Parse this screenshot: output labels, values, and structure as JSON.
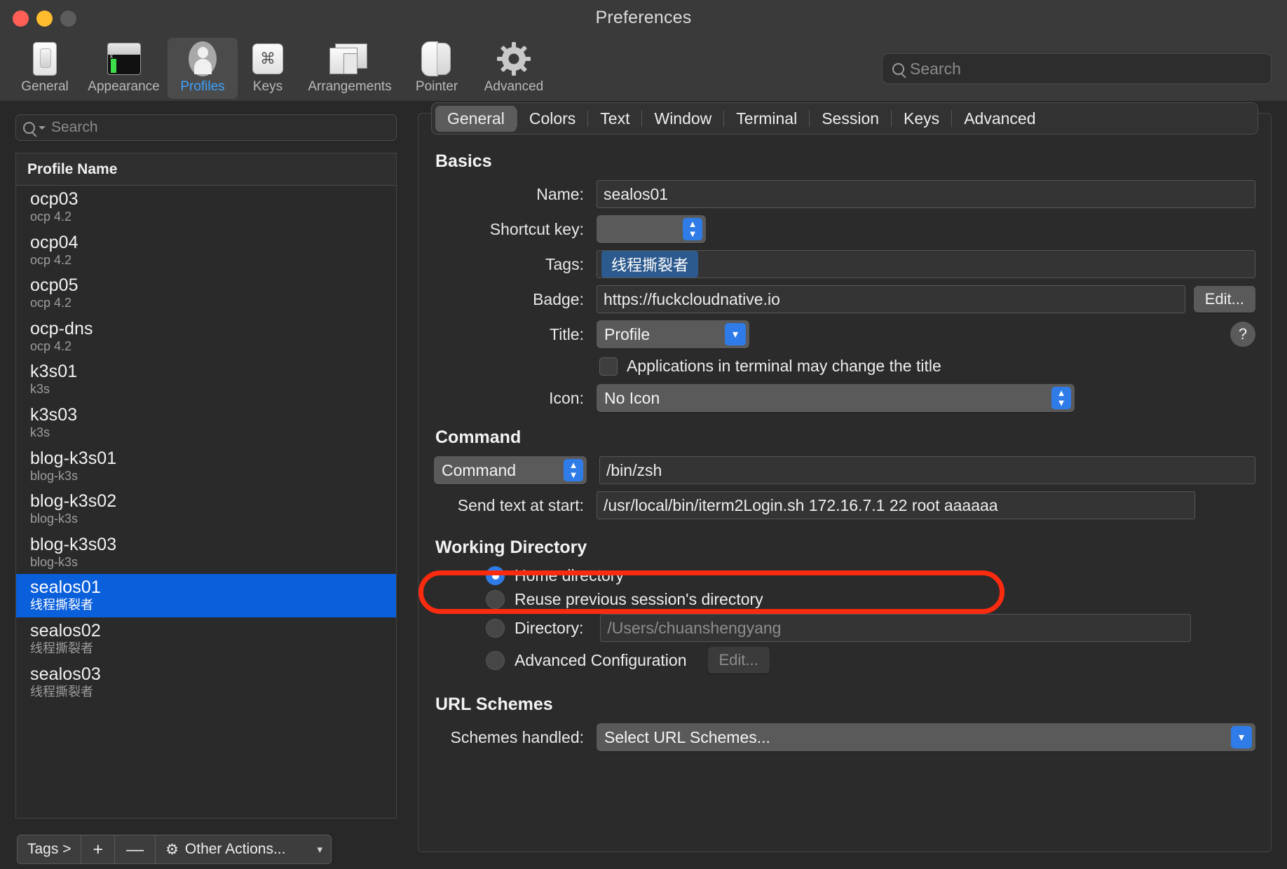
{
  "window": {
    "title": "Preferences"
  },
  "toolbar": {
    "items": [
      {
        "label": "General",
        "icon": "general-icon",
        "selected": false
      },
      {
        "label": "Appearance",
        "icon": "appearance-icon",
        "selected": false
      },
      {
        "label": "Profiles",
        "icon": "profiles-icon",
        "selected": true
      },
      {
        "label": "Keys",
        "icon": "keys-icon",
        "selected": false
      },
      {
        "label": "Arrangements",
        "icon": "arrangements-icon",
        "selected": false
      },
      {
        "label": "Pointer",
        "icon": "pointer-icon",
        "selected": false
      },
      {
        "label": "Advanced",
        "icon": "advanced-gear-icon",
        "selected": false
      }
    ],
    "search": {
      "value": "",
      "placeholder": "Search",
      "icon": "search-icon"
    }
  },
  "sidebar": {
    "search": {
      "value": "",
      "placeholder": "Search",
      "icon": "search-icon"
    },
    "list_header": "Profile Name",
    "profiles": [
      {
        "name": "ocp03",
        "tag": "ocp 4.2",
        "selected": false,
        "default": false
      },
      {
        "name": "ocp04",
        "tag": "ocp 4.2",
        "selected": false,
        "default": false
      },
      {
        "name": "ocp05",
        "tag": "ocp 4.2",
        "selected": false,
        "default": false
      },
      {
        "name": "ocp-dns",
        "tag": "ocp 4.2",
        "selected": false,
        "default": false
      },
      {
        "name": "k3s01",
        "tag": "k3s",
        "selected": false,
        "default": false
      },
      {
        "name": "k3s03",
        "tag": "k3s",
        "selected": false,
        "default": true
      },
      {
        "name": "blog-k3s01",
        "tag": "blog-k3s",
        "selected": false,
        "default": false
      },
      {
        "name": "blog-k3s02",
        "tag": "blog-k3s",
        "selected": false,
        "default": false
      },
      {
        "name": "blog-k3s03",
        "tag": "blog-k3s",
        "selected": false,
        "default": false
      },
      {
        "name": "sealos01",
        "tag": "线程撕裂者",
        "selected": true,
        "default": false
      },
      {
        "name": "sealos02",
        "tag": "线程撕裂者",
        "selected": false,
        "default": false
      },
      {
        "name": "sealos03",
        "tag": "线程撕裂者",
        "selected": false,
        "default": false
      }
    ],
    "bottom_bar": {
      "tags_label": "Tags >",
      "add_label": "+",
      "remove_label": "—",
      "other_actions_label": "Other Actions...",
      "gear_icon": "gear-icon",
      "chevron_icon": "chevron-down-icon"
    }
  },
  "tabs": [
    {
      "label": "General",
      "active": true
    },
    {
      "label": "Colors",
      "active": false
    },
    {
      "label": "Text",
      "active": false
    },
    {
      "label": "Window",
      "active": false
    },
    {
      "label": "Terminal",
      "active": false
    },
    {
      "label": "Session",
      "active": false
    },
    {
      "label": "Keys",
      "active": false
    },
    {
      "label": "Advanced",
      "active": false
    }
  ],
  "general_tab": {
    "basics": {
      "title": "Basics",
      "name": {
        "label": "Name:",
        "value": "sealos01"
      },
      "shortcut_key": {
        "label": "Shortcut key:",
        "value": ""
      },
      "tags": {
        "label": "Tags:",
        "chips": [
          "线程撕裂者"
        ]
      },
      "badge": {
        "label": "Badge:",
        "value": "https://fuckcloudnative.io",
        "edit_label": "Edit..."
      },
      "title_field": {
        "label": "Title:",
        "value": "Profile"
      },
      "app_change_title": {
        "label": "Applications in terminal may change the title",
        "checked": false
      },
      "icon_field": {
        "label": "Icon:",
        "value": "No Icon"
      },
      "help_label": "?"
    },
    "command": {
      "title": "Command",
      "type": "Command",
      "value": "/bin/zsh",
      "send_text": {
        "label": "Send text at start:",
        "value": "/usr/local/bin/iterm2Login.sh 172.16.7.1 22 root aaaaaa",
        "highlighted": true
      }
    },
    "working_directory": {
      "title": "Working Directory",
      "options": [
        {
          "label": "Home directory",
          "selected": true
        },
        {
          "label": "Reuse previous session's directory",
          "selected": false
        },
        {
          "label": "Directory:",
          "selected": false
        },
        {
          "label": "Advanced Configuration",
          "selected": false
        }
      ],
      "directory_placeholder": "/Users/chuanshengyang",
      "advanced_edit_label": "Edit..."
    },
    "url_schemes": {
      "title": "URL Schemes",
      "schemes_label": "Schemes handled:",
      "schemes_value": "Select URL Schemes..."
    }
  },
  "colors": {
    "accent_blue": "#2f7ce8",
    "selection_blue": "#0a5fdb",
    "tag_chip_blue": "#2d5a8e",
    "highlight_red": "#fb2b10",
    "window_bg": "#323232"
  }
}
